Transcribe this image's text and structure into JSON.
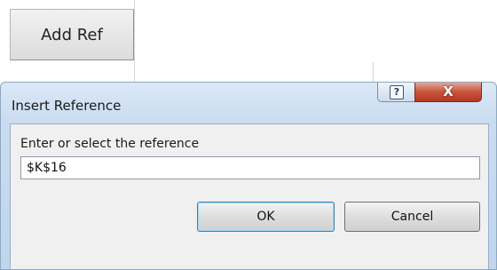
{
  "sheet": {
    "add_ref_label": "Add Ref"
  },
  "dialog": {
    "title": "Insert Reference",
    "help_glyph": "?",
    "close_glyph": "X",
    "prompt": "Enter or select the reference",
    "reference_value": "$K$16",
    "ok_label": "OK",
    "cancel_label": "Cancel"
  },
  "colors": {
    "close_button": "#c8543b",
    "title_bar": "#c9dcf1",
    "client_area": "#f0f0f0",
    "default_button_border": "#3c7fb1"
  }
}
